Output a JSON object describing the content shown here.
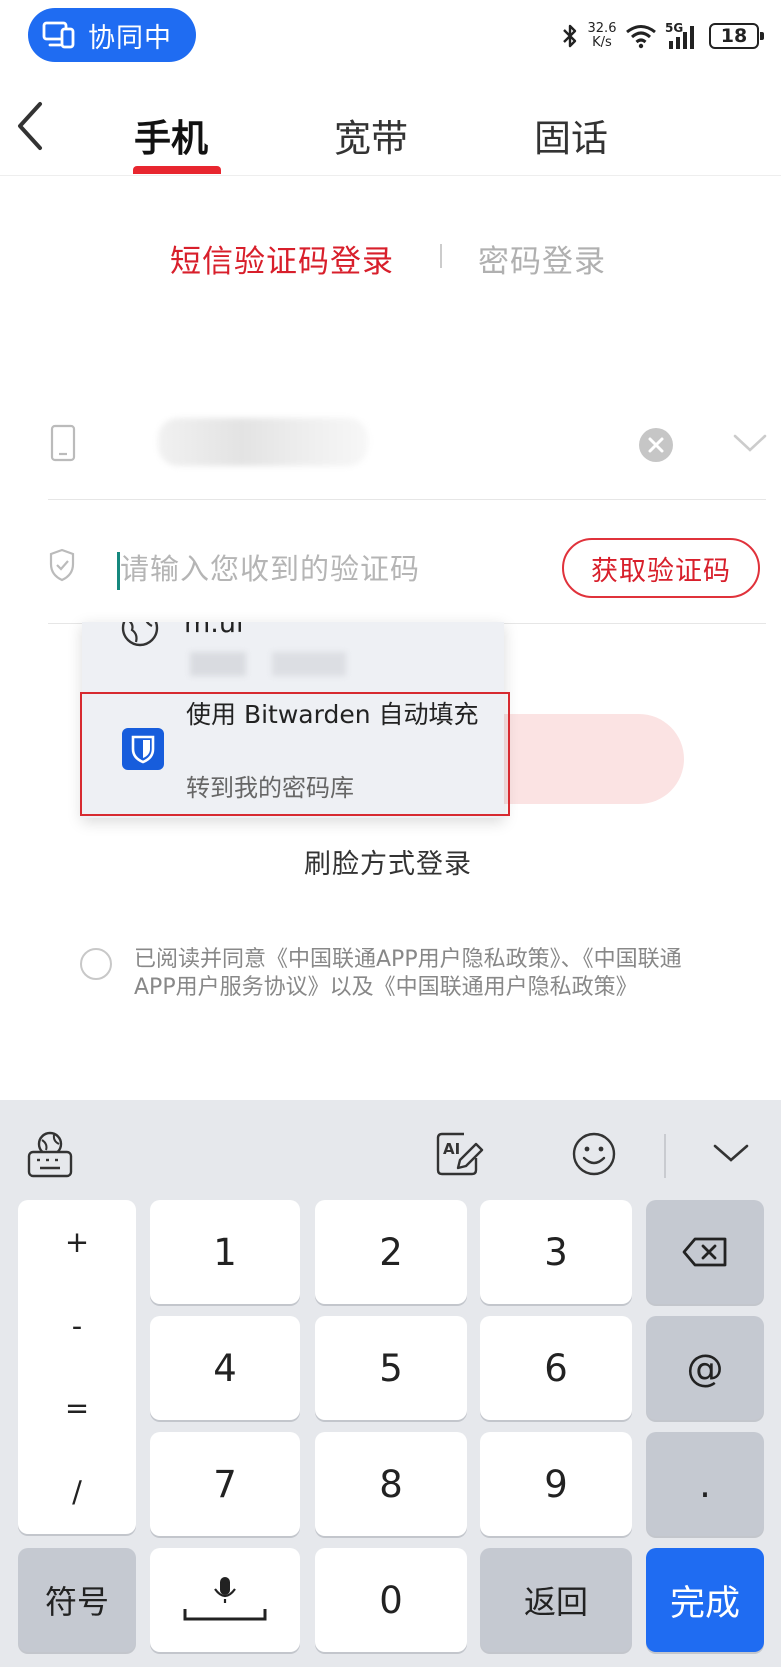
{
  "status_bar": {
    "collab_label": "协同中",
    "net_speed_value": "32.6",
    "net_speed_unit": "K/s",
    "network_type": "5G",
    "battery": "18"
  },
  "nav": {
    "tabs": [
      {
        "label": "手机",
        "active": true
      },
      {
        "label": "宽带",
        "active": false
      },
      {
        "label": "固话",
        "active": false
      }
    ]
  },
  "login_modes": {
    "sms": "短信验证码登录",
    "password": "密码登录"
  },
  "code_field": {
    "placeholder": "请输入您收到的验证码",
    "get_code_label": "获取验证码"
  },
  "autofill": {
    "suggestion_site": "m.ul",
    "bitwarden_title": "使用 Bitwarden 自动填充",
    "bitwarden_subtitle": "转到我的密码库"
  },
  "face_login": "刷脸方式登录",
  "agreement": "已阅读并同意《中国联通APP用户隐私政策》、《中国联通APP用户服务协议》以及《中国联通用户隐私政策》",
  "keyboard": {
    "symbols": [
      "+",
      "-",
      "=",
      "/"
    ],
    "digits": [
      "1",
      "2",
      "3",
      "4",
      "5",
      "6",
      "7",
      "8",
      "9",
      "0"
    ],
    "at": "@",
    "dot": ".",
    "symbol_key": "符号",
    "return_key": "返回",
    "done_key": "完成"
  },
  "colors": {
    "accent_red": "#d81f2b",
    "collab_blue": "#1f6cf2",
    "bitwarden_blue": "#175ddc"
  }
}
